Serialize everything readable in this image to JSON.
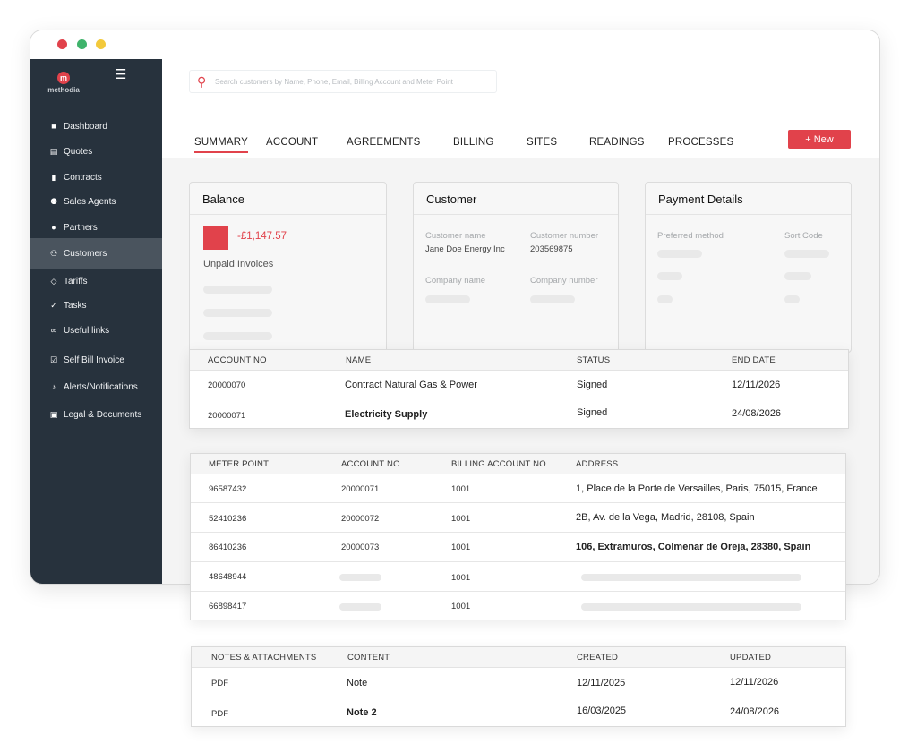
{
  "window": {
    "dots": [
      "close",
      "maximize",
      "minimize"
    ]
  },
  "sidebar": {
    "logo_text": "methodia",
    "logo_letter": "m",
    "items": [
      {
        "label": "Dashboard",
        "icon": "dashboard-icon"
      },
      {
        "label": "Quotes",
        "icon": "document-icon"
      },
      {
        "label": "Contracts",
        "icon": "bookmark-icon"
      },
      {
        "label": "Sales Agents",
        "icon": "group-icon"
      },
      {
        "label": "Partners",
        "icon": "person-icon"
      },
      {
        "label": "Customers",
        "icon": "users-icon"
      },
      {
        "label": "Tariffs",
        "icon": "tag-icon"
      },
      {
        "label": "Tasks",
        "icon": "check-icon"
      },
      {
        "label": "Useful links",
        "icon": "link-icon"
      },
      {
        "label": "Self Bill Invoice",
        "icon": "checkbox-icon"
      },
      {
        "label": "Alerts/Notifications",
        "icon": "bell-icon"
      },
      {
        "label": "Legal & Documents",
        "icon": "legal-doc-icon"
      }
    ],
    "active": "Customers"
  },
  "search": {
    "placeholder": "Search customers by Name, Phone, Email, Billing Account and Meter Point"
  },
  "tabs": [
    "SUMMARY",
    "ACCOUNT",
    "AGREEMENTS",
    "BILLING",
    "SITES",
    "READINGS",
    "PROCESSES"
  ],
  "active_tab": "SUMMARY",
  "new_button": "+ New",
  "balance": {
    "title": "Balance",
    "amount": "-£1,147.57",
    "label": "Unpaid Invoices"
  },
  "customer": {
    "title": "Customer",
    "name_label": "Customer name",
    "name_value": "Jane Doe Energy  Inc",
    "number_label": "Customer number",
    "number_value": "203569875",
    "company_label": "Company name",
    "company_number_label": "Company number"
  },
  "payment": {
    "title": "Payment Details",
    "method_label": "Preferred method",
    "sort_label": "Sort Code"
  },
  "accounts_table": {
    "headers": [
      "ACCOUNT NO",
      "NAME",
      "STATUS",
      "END DATE"
    ],
    "rows": [
      {
        "account_no": "20000070",
        "name": "Contract Natural Gas & Power",
        "status": "Signed",
        "end_date": "12/11/2026"
      },
      {
        "account_no": "20000071",
        "name": "Electricity Supply",
        "status": "Signed",
        "end_date": "24/08/2026"
      }
    ]
  },
  "meters_table": {
    "headers": [
      "METER POINT",
      "ACCOUNT NO",
      "BILLING ACCOUNT NO",
      "ADDRESS"
    ],
    "rows": [
      {
        "meter_point": "96587432",
        "account_no": "20000071",
        "billing": "1001",
        "address": "1, Place de la Porte de Versailles, Paris, 75015, France"
      },
      {
        "meter_point": "52410236",
        "account_no": "20000072",
        "billing": "1001",
        "address": "2B, Av. de la Vega, Madrid, 28108, Spain"
      },
      {
        "meter_point": "86410236",
        "account_no": "20000073",
        "billing": "1001",
        "address": "106, Extramuros, Colmenar de Oreja, 28380, Spain"
      },
      {
        "meter_point": "48648944",
        "account_no": "",
        "billing": "1001",
        "address": ""
      },
      {
        "meter_point": "66898417",
        "account_no": "",
        "billing": "1001",
        "address": ""
      }
    ]
  },
  "notes_table": {
    "headers": [
      "NOTES & ATTACHMENTS",
      "CONTENT",
      "CREATED",
      "UPDATED"
    ],
    "rows": [
      {
        "type": "PDF",
        "content": "Note",
        "created": "12/11/2025",
        "updated": "12/11/2026"
      },
      {
        "type": "PDF",
        "content": "Note 2",
        "created": "16/03/2025",
        "updated": "24/08/2026"
      }
    ]
  },
  "colors": {
    "accent": "#e1424b",
    "sidebar": "#27323d",
    "sidebar_active": "#4a545e"
  }
}
